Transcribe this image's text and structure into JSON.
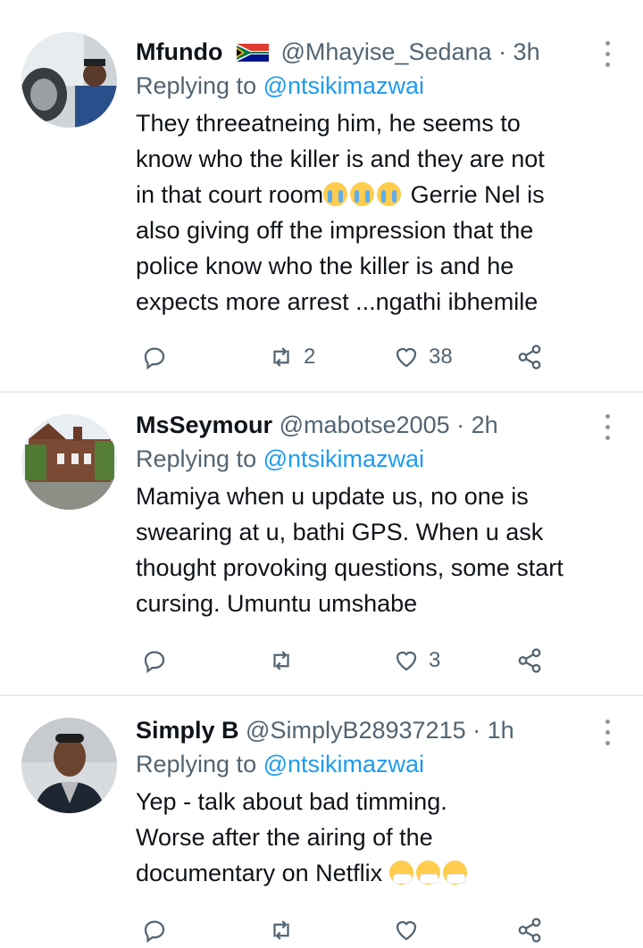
{
  "tweets": [
    {
      "name": "Mfundo",
      "flag": "south-africa-flag-icon",
      "handle": "@Mhayise_Sedana",
      "time": "· 3h",
      "replying_prefix": "Replying to",
      "replying_to": "@ntsikimazwai",
      "lines": [
        "They threeatneing him, he seems to",
        "know who the killer is and they are  not",
        "in that court room",
        "Gerrie Nel is",
        "also giving off the impression that the",
        "police know who the killer is and he",
        "expects more arrest ...ngathi ibhemile"
      ],
      "emoji": "loudly-crying-face-icon",
      "retweets": "2",
      "likes": "38"
    },
    {
      "name": "MsSeymour",
      "handle": "@mabotse2005",
      "time": "· 2h",
      "replying_prefix": "Replying to",
      "replying_to": "@ntsikimazwai",
      "lines": [
        "Mamiya when u update us, no one is",
        "swearing at u, bathi GPS. When u ask",
        "thought provoking questions, some start",
        "cursing. Umuntu umshabe"
      ],
      "retweets": "",
      "likes": "3"
    },
    {
      "name": "Simply B",
      "handle": "@SimplyB28937215",
      "time": "· 1h",
      "replying_prefix": "Replying to",
      "replying_to": "@ntsikimazwai",
      "lines": [
        "Yep - talk about bad timming.",
        "Worse after the airing of the",
        "documentary on Netflix"
      ],
      "emoji": "sneezing-face-icon",
      "retweets": "",
      "likes": ""
    }
  ],
  "colors": {
    "secondary": "#536471",
    "link": "#1d9bf0",
    "divider": "#e6ecf0"
  }
}
